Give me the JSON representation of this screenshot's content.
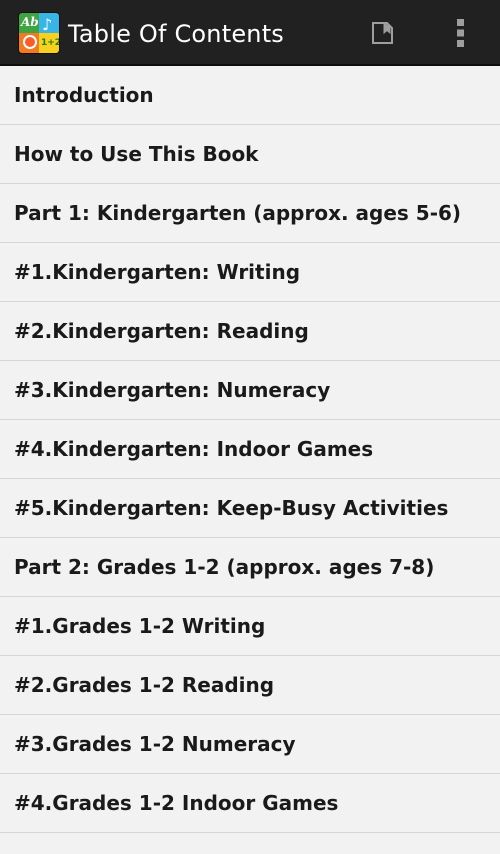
{
  "app_bar": {
    "title": "Table Of Contents",
    "app_icon_name": "app-logo-icon",
    "actions": [
      {
        "name": "bookmark-icon"
      },
      {
        "name": "overflow-menu-icon"
      }
    ],
    "background_color": "#212121",
    "title_color": "#ffffff"
  },
  "toc": {
    "items": [
      {
        "label": "Introduction"
      },
      {
        "label": "How to Use This Book"
      },
      {
        "label": "Part 1: Kindergarten (approx. ages 5-6)"
      },
      {
        "label": "#1.Kindergarten: Writing"
      },
      {
        "label": "#2.Kindergarten: Reading"
      },
      {
        "label": "#3.Kindergarten: Numeracy"
      },
      {
        "label": "#4.Kindergarten: Indoor Games"
      },
      {
        "label": "#5.Kindergarten: Keep-Busy Activities"
      },
      {
        "label": "Part 2: Grades 1-2 (approx. ages 7-8)"
      },
      {
        "label": "#1.Grades 1-2 Writing"
      },
      {
        "label": "#2.Grades 1-2 Reading"
      },
      {
        "label": "#3.Grades 1-2 Numeracy"
      },
      {
        "label": "#4.Grades 1-2 Indoor Games"
      }
    ],
    "row_background": "#f2f2f2",
    "divider_color": "#d6d6d6",
    "text_color": "#1a1a1a"
  }
}
